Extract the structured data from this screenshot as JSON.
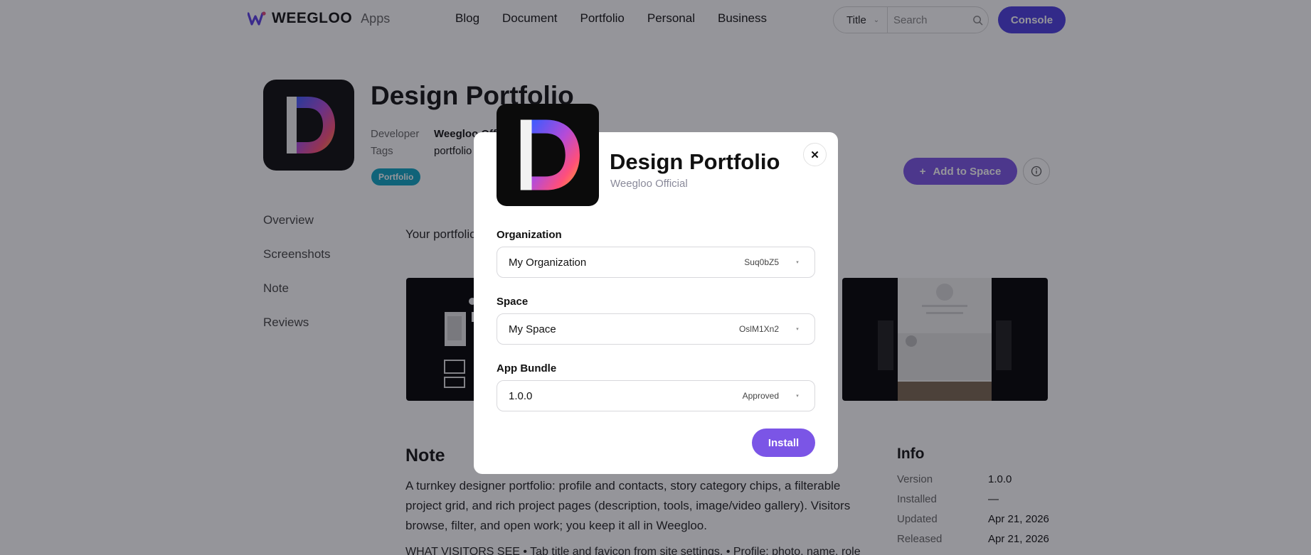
{
  "header": {
    "brand": "WEEGLOO",
    "brand_sub": "Apps",
    "nav": [
      "Blog",
      "Document",
      "Portfolio",
      "Personal",
      "Business"
    ],
    "search_scope": "Title",
    "search_placeholder": "Search",
    "console_label": "Console"
  },
  "app": {
    "title": "Design Portfolio",
    "developer_label": "Developer",
    "developer": "Weegloo Offi",
    "tags_label": "Tags",
    "tags": "portfolio",
    "tag_pill": "Portfolio",
    "add_to_space": "Add to Space"
  },
  "side_nav": [
    "Overview",
    "Screenshots",
    "Note",
    "Reviews"
  ],
  "overview_intro": "Your portfolio",
  "note": {
    "title": "Note",
    "body": "A turnkey designer portfolio: profile and contacts, story category chips, a filterable project grid, and rich project pages (description, tools, image/video gallery). Visitors browse, filter, and open work; you keep it all in Weegloo.",
    "more": "WHAT VISITORS SEE • Tab title and favicon from site settings. • Profile: photo, name, role"
  },
  "info": {
    "title": "Info",
    "rows": [
      {
        "key": "Version",
        "value": "1.0.0"
      },
      {
        "key": "Installed",
        "value": "—"
      },
      {
        "key": "Updated",
        "value": "Apr 21, 2026"
      },
      {
        "key": "Released",
        "value": "Apr 21, 2026"
      }
    ]
  },
  "modal": {
    "title": "Design Portfolio",
    "subtitle": "Weegloo Official",
    "close": "✕",
    "organization": {
      "label": "Organization",
      "value": "My Organization",
      "meta": "Suq0bZ5"
    },
    "space": {
      "label": "Space",
      "value": "My Space",
      "meta": "OslM1Xn2"
    },
    "bundle": {
      "label": "App Bundle",
      "value": "1.0.0",
      "meta": "Approved"
    },
    "install_label": "Install"
  },
  "colors": {
    "accent": "#7b55e6",
    "console": "#4b3ce0",
    "tag": "#0ea5c4"
  }
}
